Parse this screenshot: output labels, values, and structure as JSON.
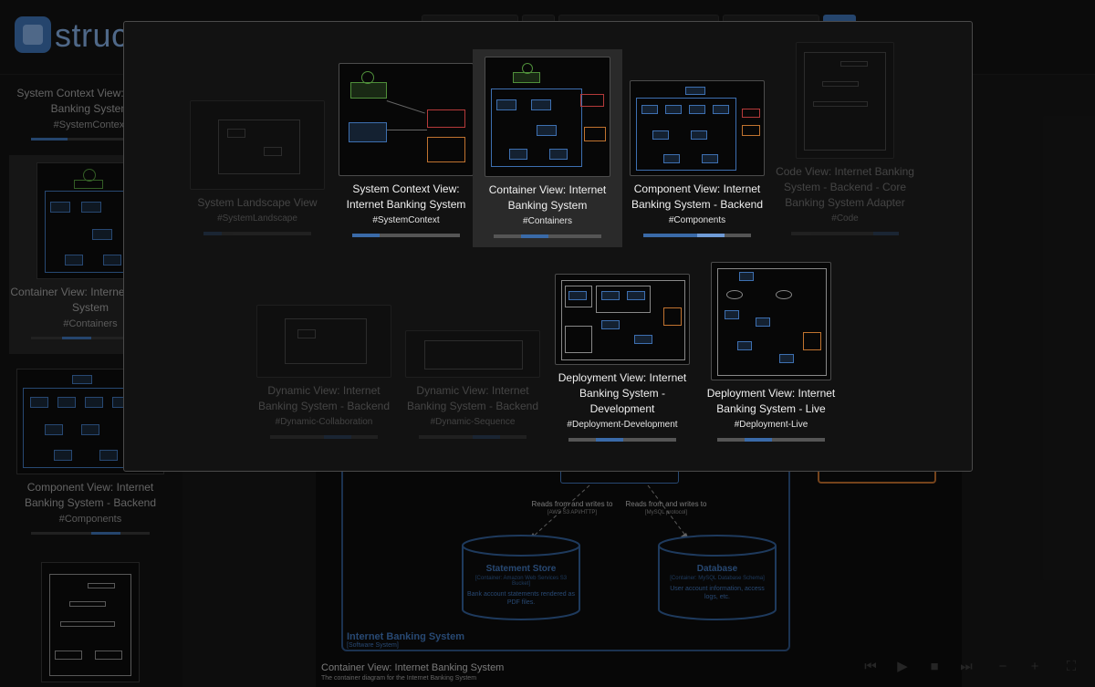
{
  "app": {
    "logo_text": "struc",
    "accent_color": "#3a6aa8"
  },
  "sidebar": {
    "items": [
      {
        "title": "System Context View: Internet Banking System",
        "tag": "#SystemContext"
      },
      {
        "title": "Container View: Internet Banking System",
        "tag": "#Containers"
      },
      {
        "title": "Component View: Internet Banking System - Backend",
        "tag": "#Components"
      }
    ]
  },
  "diagram": {
    "boundary_label": "Internet Banking System",
    "boundary_sub": "[Software System]",
    "edge1_label": "Reads from and writes to",
    "edge1_tech": "[AWS S3 API/HTTP]",
    "edge2_label": "Reads from and writes to",
    "edge2_tech": "[MySQL protocol]",
    "store_title": "Statement Store",
    "store_sub": "[Container: Amazon Web Services S3 Bucket]",
    "store_desc": "Bank account statements rendered as PDF files.",
    "db_title": "Database",
    "db_sub": "[Container: MySQL Database Schema]",
    "db_desc": "User account information, access logs, etc.",
    "title": "Container View: Internet Banking System",
    "description": "The container diagram for the Internet Banking System"
  },
  "controls": {
    "first": "⏮",
    "play": "▶",
    "stop": "■",
    "last": "⏭",
    "zoom_out": "−",
    "zoom_in": "+",
    "fullscreen": "⛶"
  },
  "views": [
    {
      "title": "System Landscape View",
      "tag": "#SystemLandscape",
      "state": "faded"
    },
    {
      "title": "System Context View: Internet Banking System",
      "tag": "#SystemContext",
      "state": "active"
    },
    {
      "title": "Container View: Internet Banking System",
      "tag": "#Containers",
      "state": "current"
    },
    {
      "title": "Component View: Internet Banking System - Backend",
      "tag": "#Components",
      "state": "active"
    },
    {
      "title": "Code View: Internet Banking System - Backend - Core Banking System Adapter",
      "tag": "#Code",
      "state": "faded"
    },
    {
      "title": "Dynamic View: Internet Banking System - Backend",
      "tag": "#Dynamic-Collaboration",
      "state": "faded"
    },
    {
      "title": "Dynamic View: Internet Banking System - Backend",
      "tag": "#Dynamic-Sequence",
      "state": "faded"
    },
    {
      "title": "Deployment View: Internet Banking System - Development",
      "tag": "#Deployment-Development",
      "state": "active"
    },
    {
      "title": "Deployment View: Internet Banking System - Live",
      "tag": "#Deployment-Live",
      "state": "active"
    }
  ]
}
